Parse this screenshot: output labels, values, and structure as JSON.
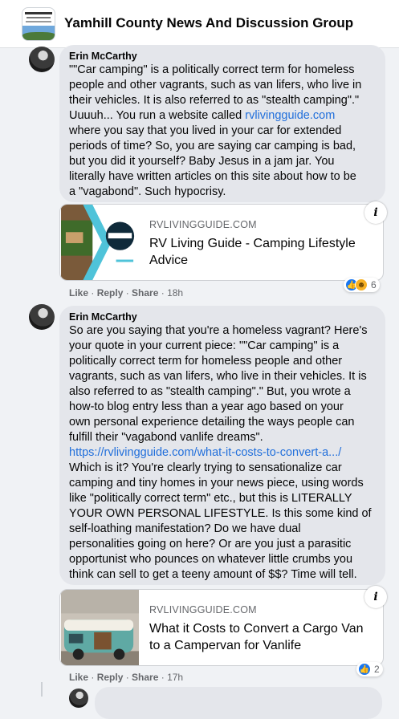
{
  "group": {
    "title": "Yamhill County News And Discussion Group"
  },
  "comments": [
    {
      "author": "Erin McCarthy",
      "text_lines": [
        "\"\"Car camping\" is a politically correct term for homeless",
        "people and other vagrants, such as van lifers, who live in",
        "their vehicles. It is also referred to as \"stealth camping\".\""
      ],
      "text_line4_prefix": "Uuuuh... You run a website called ",
      "text_line4_link": "rvlivingguide.com",
      "text_lines_after": [
        "where you say that you lived in your car for extended",
        "periods of time? So, you are saying car camping is bad,",
        "but you did it yourself? Baby Jesus in a jam jar. You",
        "literally have written articles on this site about how to be",
        "a \"vagabond\". Such hypocrisy."
      ],
      "card": {
        "domain": "RVLIVINGGUIDE.COM",
        "title": "RV Living Guide - Camping Lifestyle Advice"
      },
      "actions": {
        "like": "Like",
        "reply": "Reply",
        "share": "Share",
        "time": "18h"
      },
      "reaction_count": "6"
    },
    {
      "author": "Erin McCarthy",
      "text_lines": [
        "So are you saying that you're a homeless vagrant? Here's",
        "your quote in your current piece: \"\"Car camping\" is a",
        "politically correct term for homeless people and other",
        "vagrants, such as van lifers, who live in their vehicles. It is",
        "also referred to as \"stealth camping\".\" But, you wrote a",
        "how-to blog entry less than a year ago based on your",
        "own personal experience detailing the ways people can",
        "fulfill their \"vagabond vanlife dreams\"."
      ],
      "link": "https://rvlivingguide.com/what-it-costs-to-convert-a.../",
      "text_lines_after": [
        "Which is it? You're clearly trying to sensationalize car",
        "camping and tiny homes in your news piece, using words",
        "like \"politically correct term\" etc., but this is LITERALLY",
        "YOUR OWN PERSONAL LIFESTYLE. Is this some kind of",
        "self-loathing manifestation? Do we have dual",
        "personalities going on here? Or are you just a parasitic",
        "opportunist who pounces on whatever little crumbs you",
        "think can sell to get a teeny amount of $$? Time will tell."
      ],
      "card": {
        "domain": "RVLIVINGGUIDE.COM",
        "title": "What it Costs to Convert a Cargo Van to a Campervan for Vanlife"
      },
      "actions": {
        "like": "Like",
        "reply": "Reply",
        "share": "Share",
        "time": "17h"
      },
      "reaction_count": "2"
    }
  ],
  "icons": {
    "info": "i",
    "like_reaction": "thumbs-up-icon",
    "haha_reaction": "haha-icon"
  },
  "colors": {
    "link": "#216fdb",
    "like_blue": "#1877f2",
    "bubble": "#e4e6eb",
    "background": "#f0f2f5"
  }
}
